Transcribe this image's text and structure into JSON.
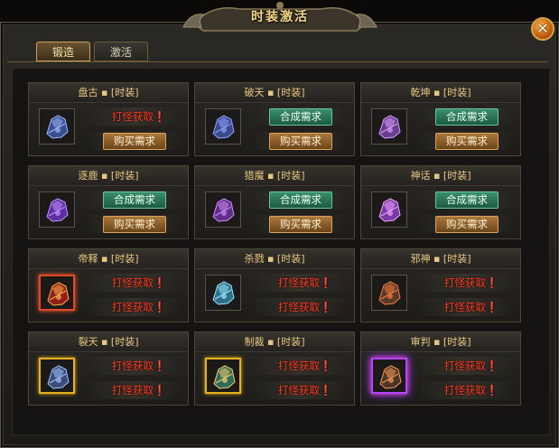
{
  "window": {
    "title": "时装激活",
    "close_symbol": "✕"
  },
  "tabs": [
    {
      "label": "锻造",
      "active": true
    },
    {
      "label": "激活",
      "active": false
    }
  ],
  "cards": [
    {
      "name": "盘古 ▪ [时装]",
      "icon": "armor-icon-pangu",
      "rows": [
        {
          "type": "hunt",
          "text": "打怪获取❗"
        },
        {
          "type": "buy",
          "text": "购买需求"
        }
      ]
    },
    {
      "name": "破天 ▪ [时装]",
      "icon": "armor-icon-potian",
      "rows": [
        {
          "type": "synth",
          "text": "合成需求"
        },
        {
          "type": "buy",
          "text": "购买需求"
        }
      ]
    },
    {
      "name": "乾坤 ▪ [时装]",
      "icon": "armor-icon-qiankun",
      "rows": [
        {
          "type": "synth",
          "text": "合成需求"
        },
        {
          "type": "buy",
          "text": "购买需求"
        }
      ]
    },
    {
      "name": "逐鹿 ▪ [时装]",
      "icon": "armor-icon-zhulu",
      "rows": [
        {
          "type": "synth",
          "text": "合成需求"
        },
        {
          "type": "buy",
          "text": "购买需求"
        }
      ]
    },
    {
      "name": "猎魔 ▪ [时装]",
      "icon": "armor-icon-liemo",
      "rows": [
        {
          "type": "synth",
          "text": "合成需求"
        },
        {
          "type": "buy",
          "text": "购买需求"
        }
      ]
    },
    {
      "name": "神话 ▪ [时装]",
      "icon": "armor-icon-shenhua",
      "rows": [
        {
          "type": "synth",
          "text": "合成需求"
        },
        {
          "type": "buy",
          "text": "购买需求"
        }
      ]
    },
    {
      "name": "帝释 ▪ [时装]",
      "icon": "armor-icon-dishi",
      "rows": [
        {
          "type": "hunt",
          "text": "打怪获取❗"
        },
        {
          "type": "hunt",
          "text": "打怪获取❗"
        }
      ]
    },
    {
      "name": "杀戮 ▪ [时装]",
      "icon": "armor-icon-shalu",
      "rows": [
        {
          "type": "hunt",
          "text": "打怪获取❗"
        },
        {
          "type": "hunt",
          "text": "打怪获取❗"
        }
      ]
    },
    {
      "name": "邪神 ▪ [时装]",
      "icon": "armor-icon-xieshen",
      "rows": [
        {
          "type": "hunt",
          "text": "打怪获取❗"
        },
        {
          "type": "hunt",
          "text": "打怪获取❗"
        }
      ]
    },
    {
      "name": "裂天 ▪ [时装]",
      "icon": "armor-icon-lietian",
      "rows": [
        {
          "type": "hunt",
          "text": "打怪获取❗"
        },
        {
          "type": "hunt",
          "text": "打怪获取❗"
        }
      ]
    },
    {
      "name": "制裁 ▪ [时装]",
      "icon": "armor-icon-zhicai",
      "rows": [
        {
          "type": "hunt",
          "text": "打怪获取❗"
        },
        {
          "type": "hunt",
          "text": "打怪获取❗"
        }
      ]
    },
    {
      "name": "审判 ▪ [时装]",
      "icon": "armor-icon-shenpan",
      "rows": [
        {
          "type": "hunt",
          "text": "打怪获取❗"
        },
        {
          "type": "hunt",
          "text": "打怪获取❗"
        }
      ]
    }
  ],
  "colors": {
    "title_gold": "#f4d98a",
    "hunt_red": "#ff3b24",
    "button_green": "#2b7356",
    "button_brown": "#8a5a28"
  }
}
